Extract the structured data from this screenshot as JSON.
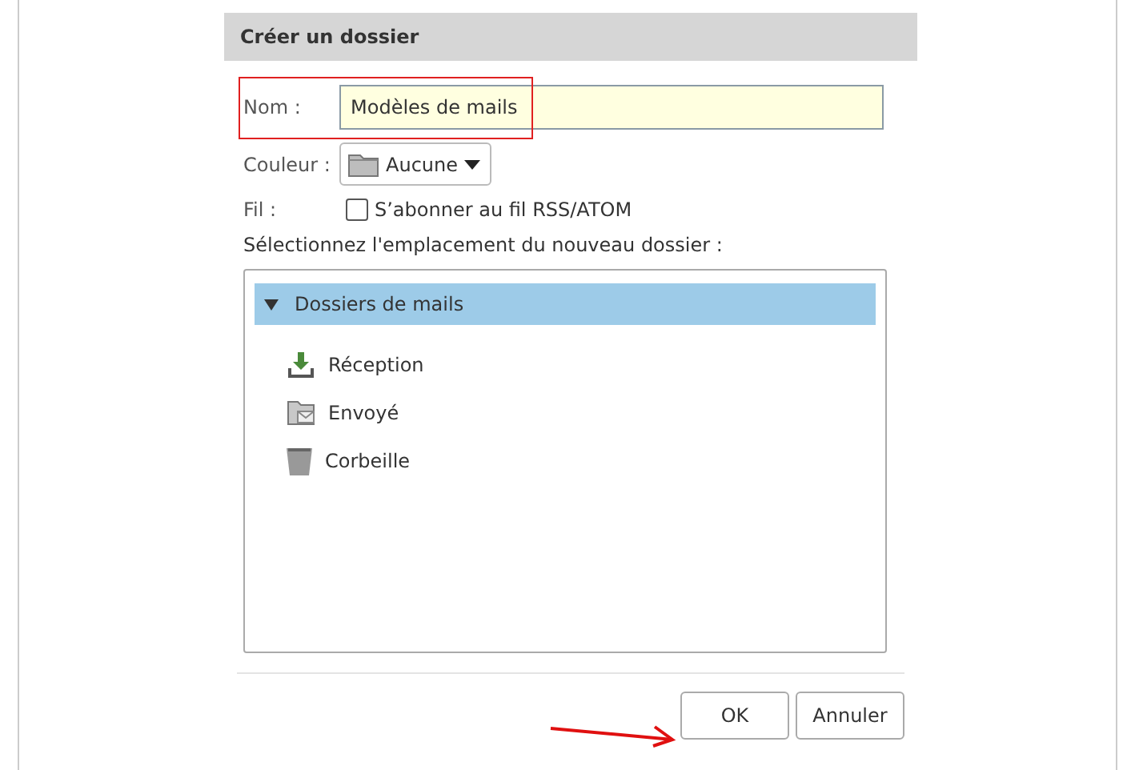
{
  "dialog": {
    "title": "Créer un dossier",
    "name_field": {
      "label": "Nom :",
      "value": "Modèles de mails"
    },
    "color_field": {
      "label": "Couleur :",
      "value": "Aucune"
    },
    "feed_field": {
      "label": "Fil :",
      "option": "S’abonner au fil RSS/ATOM",
      "checked": false
    },
    "location_label": "Sélectionnez l'emplacement du nouveau dossier :",
    "tree": [
      {
        "label": "Dossiers de mails",
        "selected": true,
        "expanded": true,
        "children": [
          {
            "label": "Réception",
            "kind": "inbox",
            "selected": false
          },
          {
            "label": "Envoyé",
            "kind": "sent",
            "selected": false
          },
          {
            "label": "Corbeille",
            "kind": "trash",
            "selected": false
          }
        ]
      }
    ],
    "buttons": [
      {
        "label": "OK"
      },
      {
        "label": "Annuler"
      }
    ]
  }
}
